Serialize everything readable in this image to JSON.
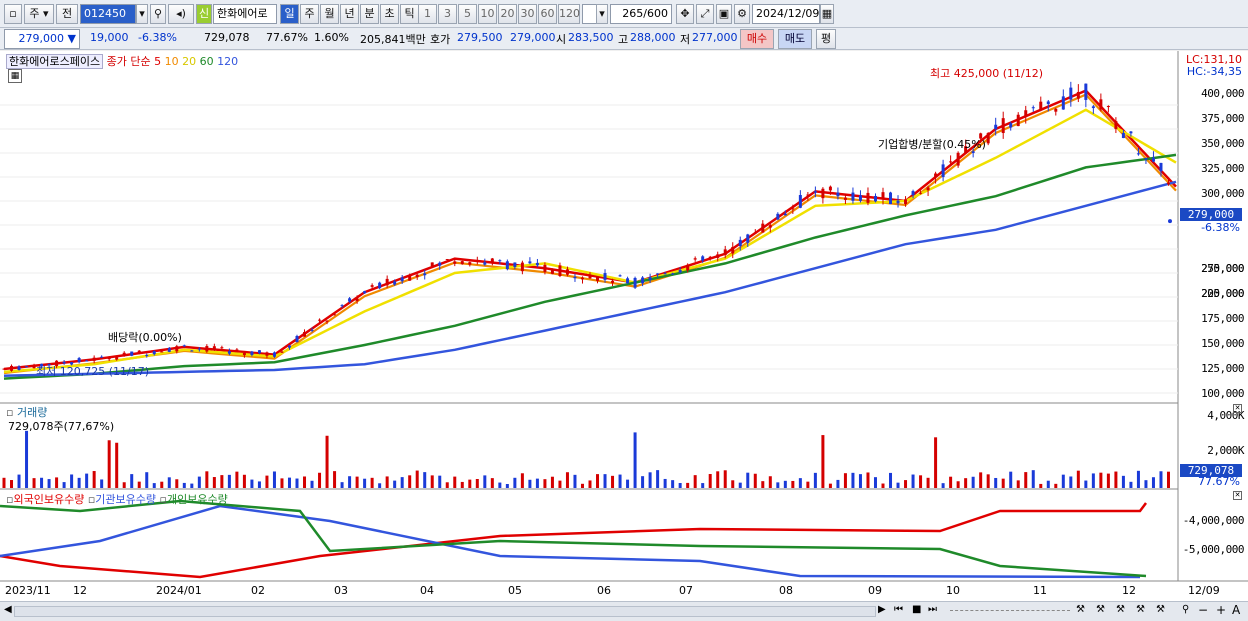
{
  "toolbar": {
    "period_selector": "주",
    "prev_label": "전",
    "code_value": "012450",
    "stock_tag": "신",
    "stock_name": "한화에어로",
    "periods": [
      "일",
      "주",
      "월",
      "년",
      "분",
      "초",
      "틱"
    ],
    "active_period": "일",
    "intervals": [
      "1",
      "3",
      "5",
      "10",
      "20",
      "30",
      "60",
      "120"
    ],
    "count_value": "265",
    "count_total": "/600",
    "date_value": "2024/12/09"
  },
  "quote": {
    "price": "279,000",
    "change": "19,000",
    "change_pct": "-6.38%",
    "volume": "729,078",
    "volume_pct": "77.67%",
    "turnover_pct": "1.60%",
    "amount": "205,841백만",
    "bid_label": "호가",
    "bid": "279,500",
    "ask": "279,000",
    "open_label": "시",
    "open": "283,500",
    "high_label": "고",
    "high": "288,000",
    "low_label": "저",
    "low": "277,000",
    "buy_label": "매수",
    "sell_label": "매도",
    "eval_label": "평"
  },
  "legend": {
    "stock": "한화에어로스페이스",
    "ma_label": "종가 단순",
    "ma_periods": [
      "5",
      "10",
      "20",
      "60",
      "120"
    ],
    "ma_colors": [
      "#e00000",
      "#f08a00",
      "#f0e000",
      "#1f8a2a",
      "#3355dd"
    ],
    "lc": "LC:131,10",
    "hc": "HC:-34,35",
    "volume_label": "거래량",
    "volume_info": "729,078주(77,67%)",
    "holding_labels": [
      "외국인보유수량",
      "기관보유수량",
      "개인보유수량"
    ],
    "holding_colors": [
      "#e00000",
      "#3355dd",
      "#1f8a2a"
    ]
  },
  "annotations": {
    "high_note": "최고 425,000 (11/12)",
    "low_note": "최저 120,725 (11/17)",
    "dividend_note": "배당락(0.00%)",
    "merger_note": "기업합병/분할(0.45%)"
  },
  "price_axis": [
    "400,000",
    "375,000",
    "350,000",
    "325,000",
    "300,000",
    "275,000",
    "250,000",
    "225,000",
    "200,000",
    "175,000",
    "150,000",
    "125,000",
    "100,000"
  ],
  "price_box": {
    "value": "279,000",
    "pct": "-6.38%"
  },
  "volume_axis": [
    "4,000K",
    "2,000K"
  ],
  "volume_box": {
    "value": "729,078",
    "pct": "77.67%"
  },
  "holding_axis": [
    "-4,000,000",
    "-5,000,000"
  ],
  "x_axis": [
    "2023/11",
    "12",
    "2024/01",
    "02",
    "03",
    "04",
    "05",
    "06",
    "07",
    "08",
    "09",
    "10",
    "11",
    "12",
    "12/09"
  ],
  "chart_data": {
    "type": "candlestick",
    "title": "한화에어로스페이스",
    "x": [
      "2023/11",
      "12",
      "2024/01",
      "02",
      "03",
      "04",
      "05",
      "06",
      "07",
      "08",
      "09",
      "10",
      "11",
      "12"
    ],
    "series": [
      {
        "name": "5",
        "values": [
          125000,
          135000,
          148000,
          140000,
          205000,
          240000,
          230000,
          215000,
          245000,
          310000,
          300000,
          375000,
          415000,
          315000
        ]
      },
      {
        "name": "20",
        "values": [
          122000,
          130000,
          145000,
          138000,
          185000,
          225000,
          235000,
          215000,
          240000,
          295000,
          300000,
          345000,
          395000,
          340000
        ]
      },
      {
        "name": "60",
        "values": [
          115000,
          120000,
          128000,
          132000,
          150000,
          170000,
          195000,
          215000,
          235000,
          262000,
          285000,
          305000,
          335000,
          348000
        ]
      },
      {
        "name": "120",
        "values": [
          118000,
          120000,
          122000,
          124000,
          130000,
          145000,
          165000,
          185000,
          205000,
          230000,
          255000,
          270000,
          295000,
          320000
        ]
      }
    ],
    "ylim": [
      100000,
      425000
    ],
    "last_price": 279000
  }
}
